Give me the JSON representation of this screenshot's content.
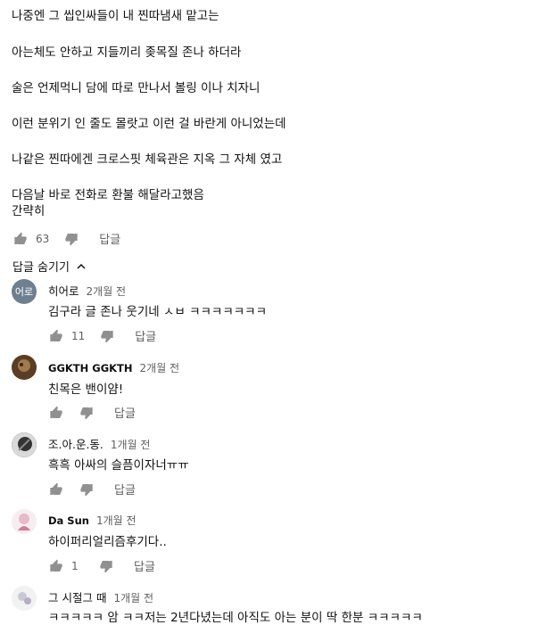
{
  "main_comment": {
    "lines": [
      "나중엔 그 씹인싸들이 내 찐따냄새 맡고는",
      "아는체도 안하고 지들끼리 좆목질 존나 하더라",
      "술은 언제먹니 담에 따로 만나서 볼링 이나 치자니",
      "이런 분위기 인 줄도 몰랏고 이런 걸 바란게 아니었는데",
      "나같은 찐따에겐 크로스핏 체육관은 지옥 그 자체 였고",
      "다음날 바로 전화로 환불 해달라고했음",
      "간략히"
    ],
    "likes": "63",
    "reply_label": "답글"
  },
  "toggle": {
    "label": "답글 숨기기"
  },
  "replies": [
    {
      "author": "히어로",
      "avatar_text": "어로",
      "time": "2개월 전",
      "text": "김구라 글 존나 웃기네 ㅅㅂ ㅋㅋㅋㅋㅋㅋㅋ",
      "likes": "11",
      "reply_label": "답글",
      "avatar_color": "#6f7f8f"
    },
    {
      "author": "GGKTH GGKTH",
      "avatar_text": "",
      "time": "2개월 전",
      "text": "친목은 밴이얌!",
      "likes": "",
      "reply_label": "답글",
      "avatar_color": "#6b4a2f"
    },
    {
      "author": "조.아.운.동.",
      "avatar_text": "",
      "time": "1개월 전",
      "text": "흑흑 아싸의 슬픔이자너ㅠㅠ",
      "likes": "",
      "reply_label": "답글",
      "avatar_color": "#4a4a4a"
    },
    {
      "author": "Da Sun",
      "avatar_text": "",
      "time": "1개월 전",
      "text": "하이퍼리얼리즘후기다..",
      "likes": "1",
      "reply_label": "답글",
      "avatar_color": "#f3e6ec"
    },
    {
      "author": "그 시절그 때",
      "avatar_text": "",
      "time": "1개월 전",
      "text": "ㅋㅋㅋㅋㅋ 암 ㅋㅋ저는 2년다녔는데 아직도 아는 분이 딱 한분 ㅋㅋㅋㅋㅋ",
      "likes": "",
      "reply_label": "",
      "avatar_color": "#eeeeee"
    }
  ]
}
